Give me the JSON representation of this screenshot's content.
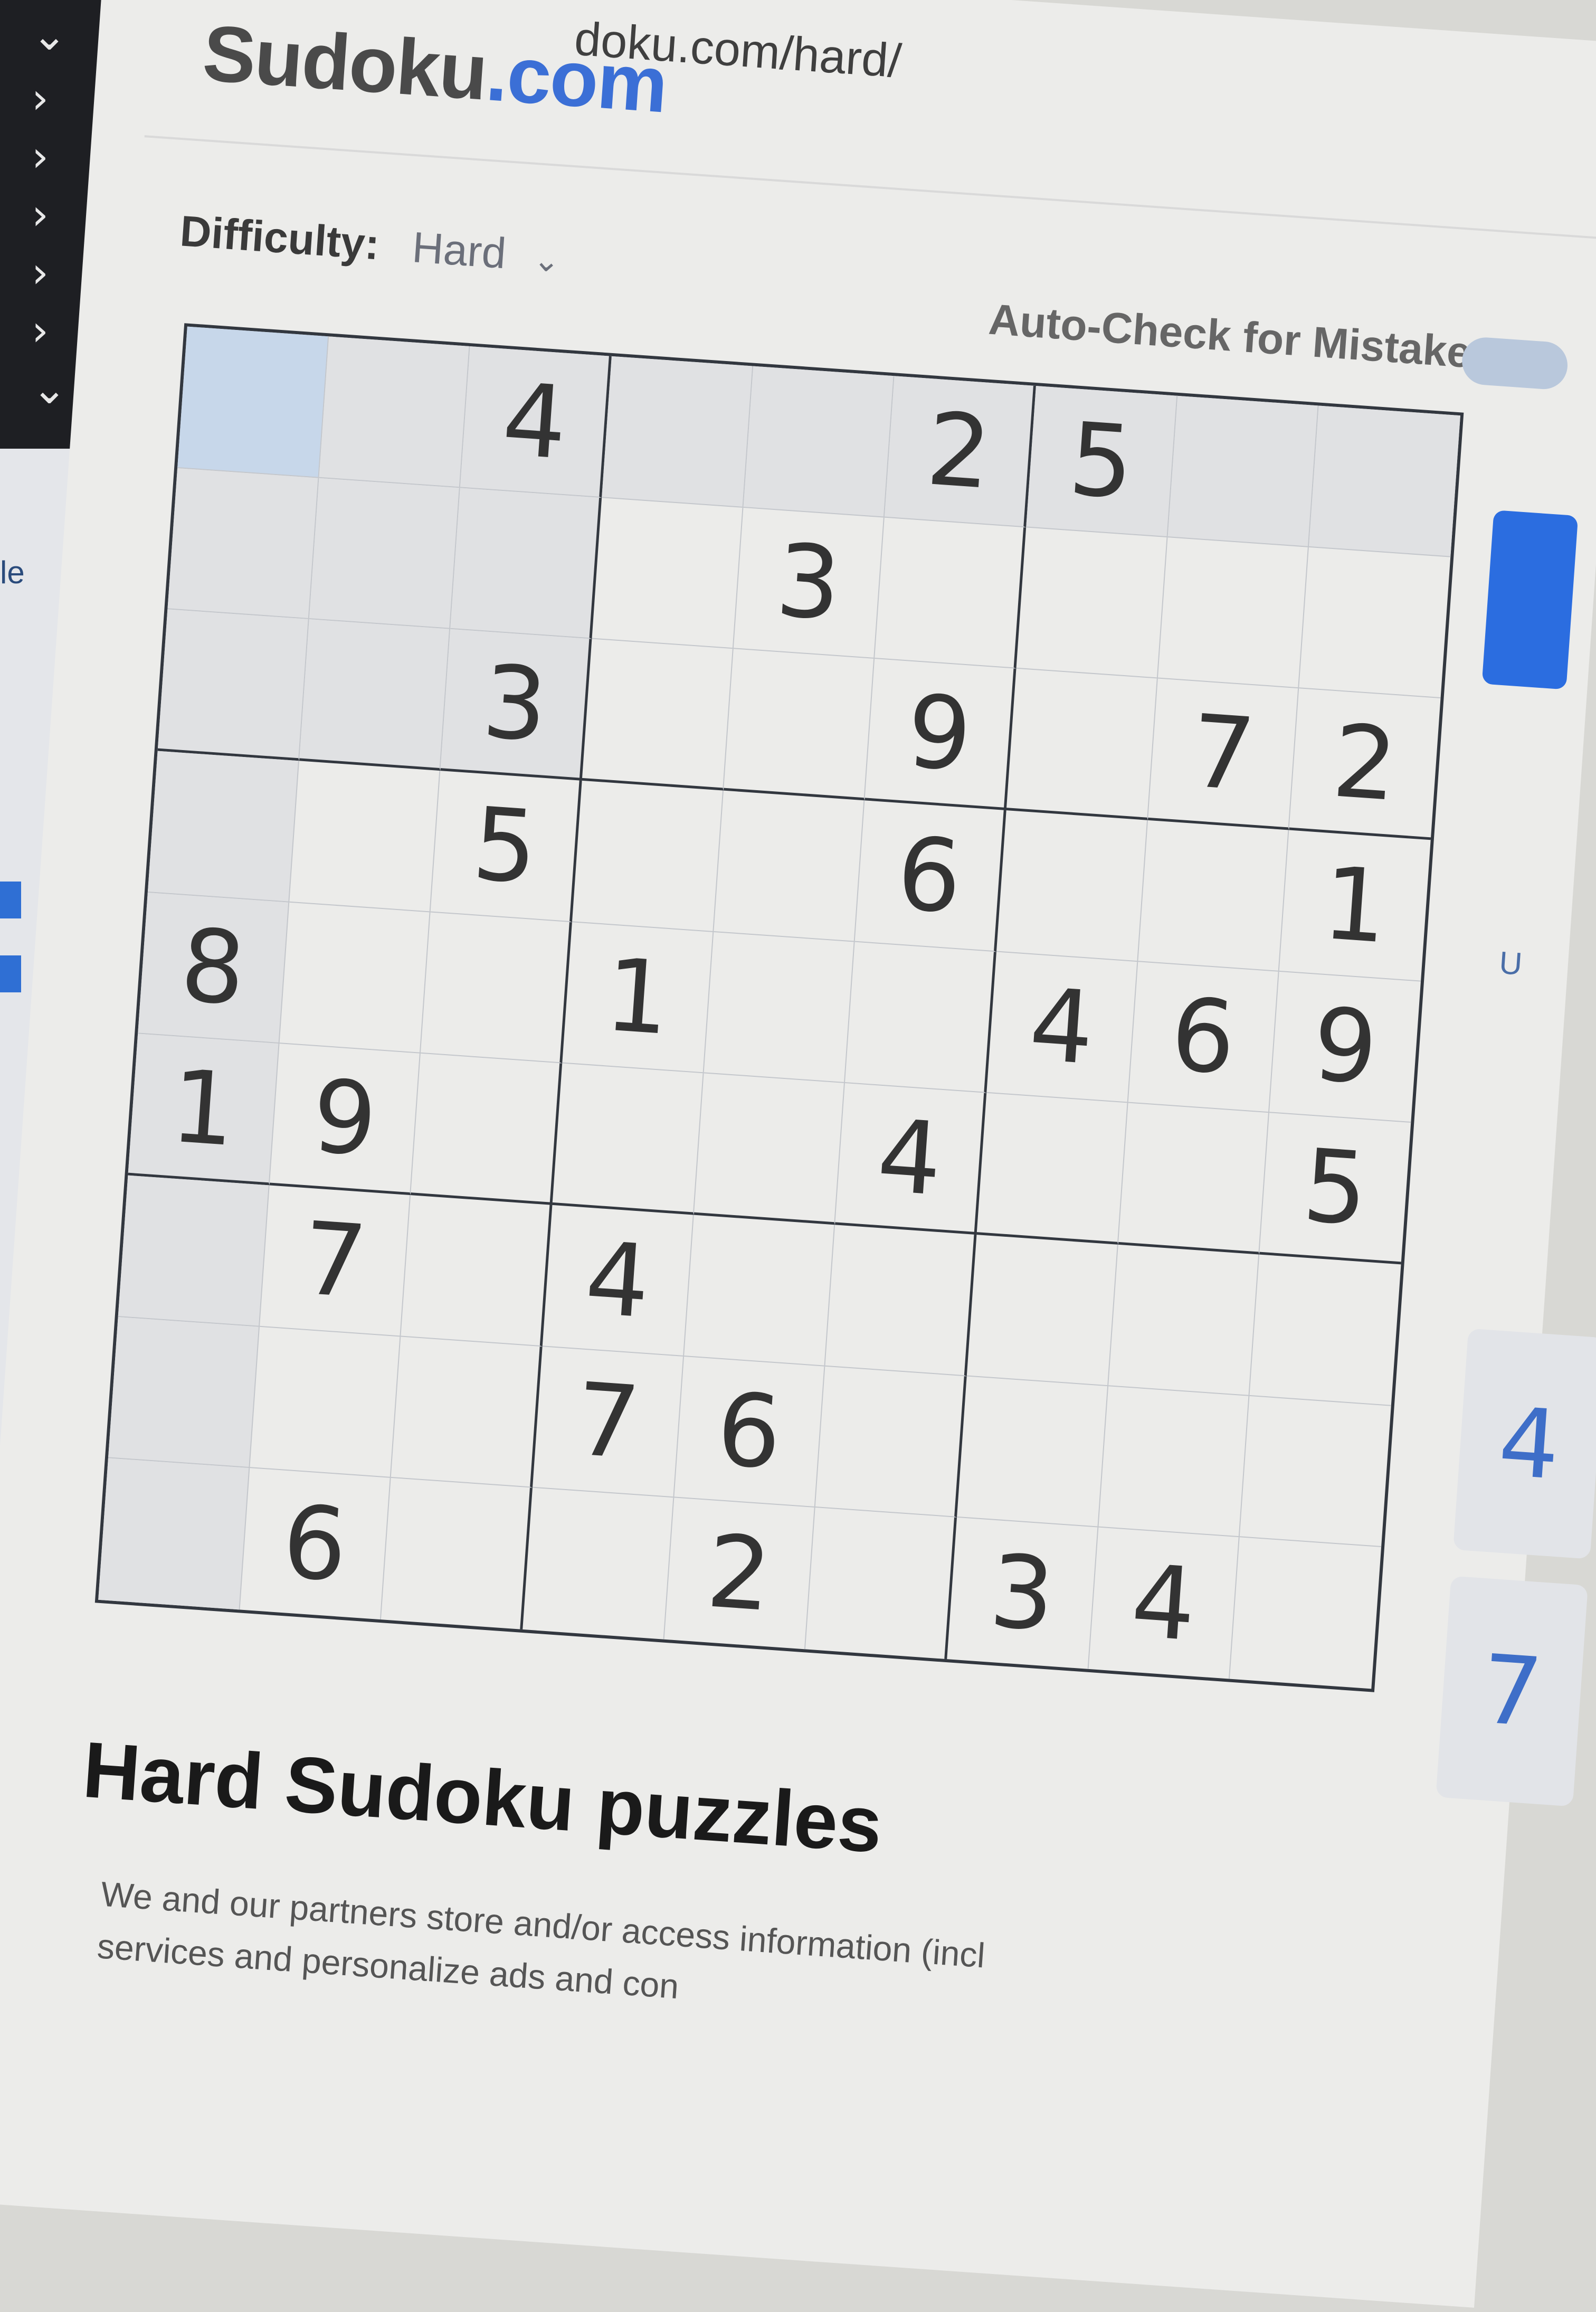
{
  "address_bar": {
    "url_text": "doku.com/hard/"
  },
  "site": {
    "logo_text": "Sudoku",
    "logo_suffix": ".com"
  },
  "difficulty": {
    "label": "Difficulty:",
    "value": "Hard"
  },
  "auto_check": {
    "label": "Auto-Check for Mistakes"
  },
  "board": {
    "rows": [
      [
        "",
        "",
        "4",
        "",
        "",
        "2",
        "5",
        "",
        ""
      ],
      [
        "",
        "",
        "",
        "",
        "3",
        "",
        "",
        "",
        ""
      ],
      [
        "",
        "",
        "3",
        "",
        "",
        "9",
        "",
        "7",
        "2"
      ],
      [
        "",
        "",
        "5",
        "",
        "",
        "6",
        "",
        "",
        "1"
      ],
      [
        "8",
        "",
        "",
        "1",
        "",
        "",
        "4",
        "6",
        "9"
      ],
      [
        "1",
        "9",
        "",
        "",
        "",
        "4",
        "",
        "",
        "5"
      ],
      [
        "",
        "7",
        "",
        "4",
        "",
        "",
        "",
        "",
        ""
      ],
      [
        "",
        "",
        "",
        "7",
        "6",
        "",
        "",
        "",
        ""
      ],
      [
        "",
        "6",
        "",
        "",
        "2",
        "",
        "3",
        "4",
        ""
      ]
    ]
  },
  "numpad": {
    "keys": [
      "4",
      "7"
    ]
  },
  "right_panel": {
    "partial_text": "U"
  },
  "left_panel": {
    "partial_text": "le"
  },
  "content": {
    "heading": "Hard Sudoku puzzles",
    "cookie_line1": "We and our partners store and/or access information (incl",
    "cookie_line2": "services and personalize ads and con"
  },
  "colors": {
    "accent": "#3b6fd6",
    "selected_cell": "#c7d7ea",
    "highlight_cell": "#e0e1e3",
    "grid_line": "#32373f"
  }
}
